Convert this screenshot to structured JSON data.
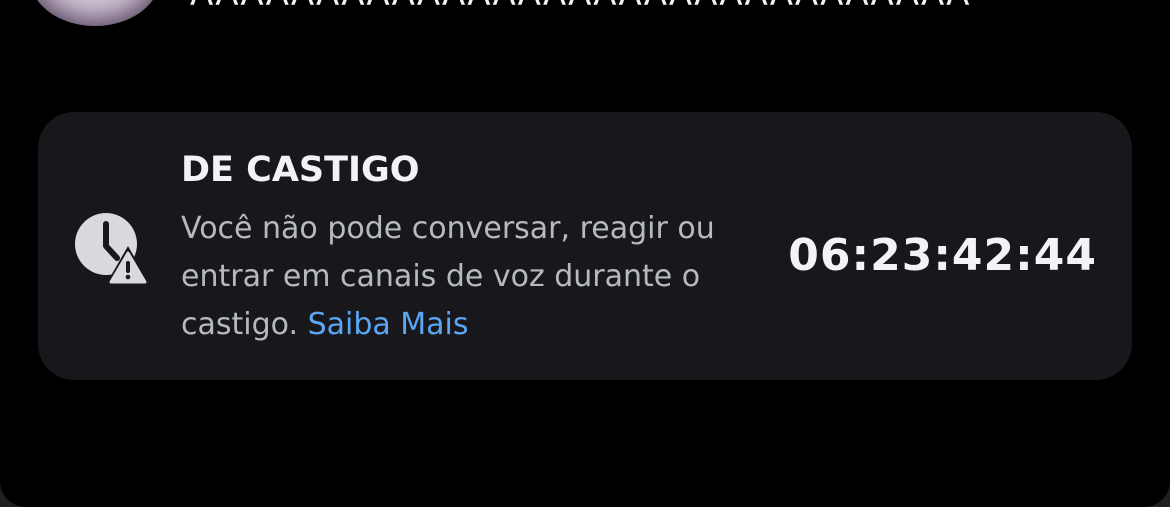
{
  "header": {
    "truncated_text": "AAAAAAAAAAAAAAAAAAAAAAAAAAAAAAA"
  },
  "timeout_card": {
    "title": "DE CASTIGO",
    "description": "Você não pode conversar, reagir ou entrar em canais de voz durante o castigo.",
    "link_label": "Saiba Mais",
    "timer": "06:23:42:44",
    "icon": "clock-warning-icon"
  },
  "colors": {
    "background": "#000000",
    "card": "#18181c",
    "link": "#5aa6f2",
    "title_text": "#f2f3f5",
    "body_text": "#b5bac1"
  }
}
